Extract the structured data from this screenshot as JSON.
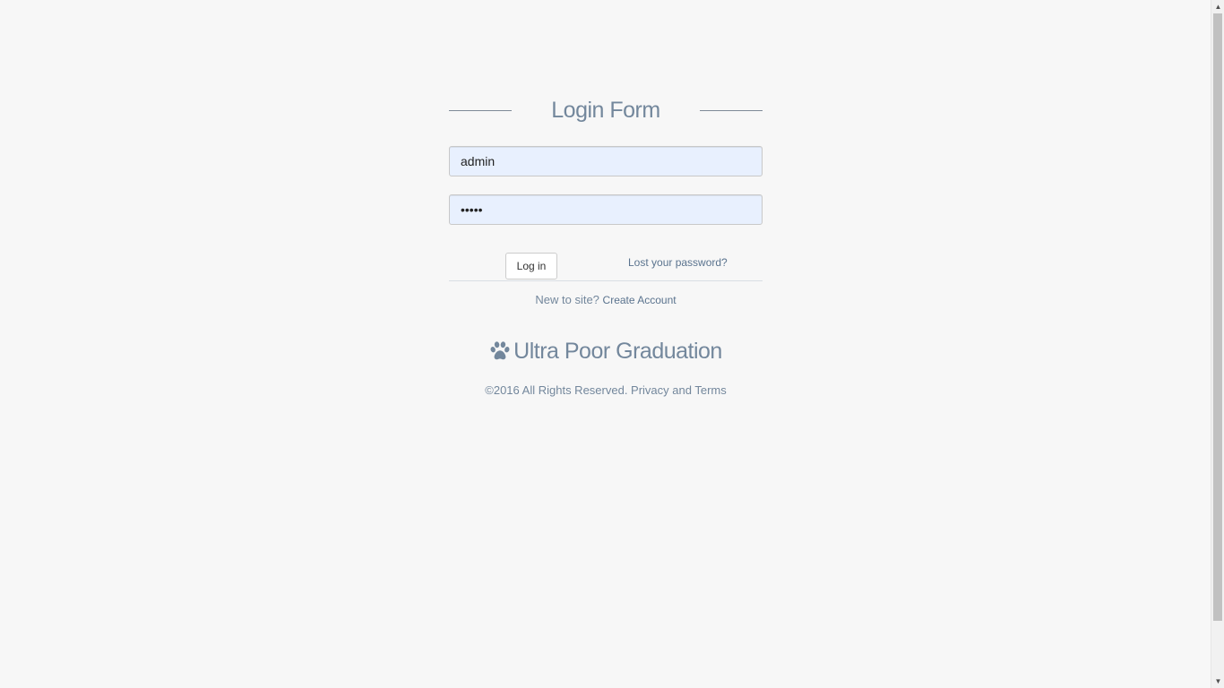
{
  "form": {
    "title": "Login Form",
    "username_value": "admin",
    "password_value": "•••••",
    "login_label": "Log in",
    "lost_password_label": "Lost your password?",
    "new_to_site_text": "New to site?",
    "create_account_label": "Create Account"
  },
  "brand": {
    "name": "Ultra Poor Graduation",
    "icon": "paw-icon"
  },
  "footer": {
    "copyright": "©2016 All Rights Reserved. Privacy and Terms"
  },
  "colors": {
    "page_background": "#f7f7f7",
    "text_muted": "#73879c",
    "link": "#5a738e",
    "input_autofill": "#e8f0fe"
  }
}
